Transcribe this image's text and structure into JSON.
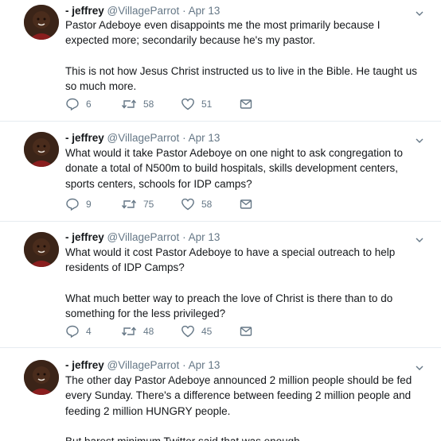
{
  "tweets": [
    {
      "name": "- jeffrey",
      "handle": "@VillageParrot",
      "separator": "·",
      "date": "Apr 13",
      "paragraphs": [
        "Pastor Adeboye even disappoints me the most primarily because I expected more; secondarily because he's my pastor.",
        "This is not how Jesus Christ instructed us to live in the Bible. He taught us so much more."
      ],
      "replies": "6",
      "retweets": "58",
      "likes": "51"
    },
    {
      "name": "- jeffrey",
      "handle": "@VillageParrot",
      "separator": "·",
      "date": "Apr 13",
      "paragraphs": [
        "What would it take Pastor Adeboye on one night to ask congregation to donate a total of N500m to build hospitals, skills development centers, sports centers, schools for IDP camps?"
      ],
      "replies": "9",
      "retweets": "75",
      "likes": "58"
    },
    {
      "name": "- jeffrey",
      "handle": "@VillageParrot",
      "separator": "·",
      "date": "Apr 13",
      "paragraphs": [
        "What would it cost Pastor Adeboye to have a special outreach to help residents of IDP Camps?",
        "What much better way to preach the love of Christ is there than to do something for the less privileged?"
      ],
      "replies": "4",
      "retweets": "48",
      "likes": "45"
    },
    {
      "name": "- jeffrey",
      "handle": "@VillageParrot",
      "separator": "·",
      "date": "Apr 13",
      "paragraphs": [
        "The other day Pastor Adeboye announced 2 million people should be fed every Sunday. There's a difference between feeding 2 million people and feeding 2 million HUNGRY people.",
        "But barest minimum Twitter said that was enough."
      ]
    }
  ],
  "colors": {
    "text": "#14171a",
    "secondary": "#657786",
    "divider": "#e6ecf0"
  },
  "icons": [
    "reply-icon",
    "retweet-icon",
    "like-icon",
    "dm-icon",
    "chevron-down-icon"
  ]
}
